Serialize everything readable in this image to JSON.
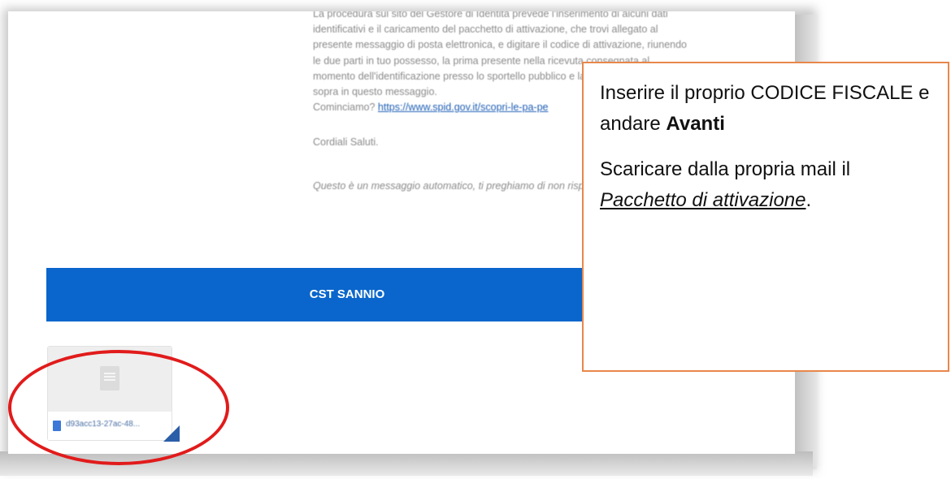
{
  "email": {
    "paragraph_lines": [
      "La procedura sul sito del Gestore di Identità prevede l'inserimento di alcuni dati",
      "identificativi e il caricamento del pacchetto di attivazione, che trovi allegato al",
      "presente messaggio di posta elettronica, e digitare il codice di attivazione, riunendo",
      "le due parti in tuo possesso, la prima presente nella ricevuta consegnata al",
      "momento dell'identificazione presso lo sportello pubblico e la seconda indicata",
      "sopra in questo messaggio."
    ],
    "start_prompt": "Cominciamo?",
    "link_text": "https://www.spid.gov.it/scopri-le-pa-pe",
    "greeting": "Cordiali Saluti.",
    "auto_note": "Questo è un messaggio automatico, ti preghiamo di non rispondere."
  },
  "footer": {
    "label": "CST SANNIO",
    "color": "#0a66cc"
  },
  "attachment": {
    "filename": "d93acc13-27ac-48...",
    "icon": "document-icon"
  },
  "callout": {
    "line1_prefix": "Inserire il proprio CODICE FISCALE e andare ",
    "line1_bold": "Avanti",
    "line2_prefix": "Scaricare dalla propria mail il ",
    "line2_emph": "Pacchetto di attivazione",
    "line2_suffix": "."
  },
  "colors": {
    "ring": "#e11b1b",
    "callout_border": "#e8874a",
    "link": "#1f5fb5"
  }
}
